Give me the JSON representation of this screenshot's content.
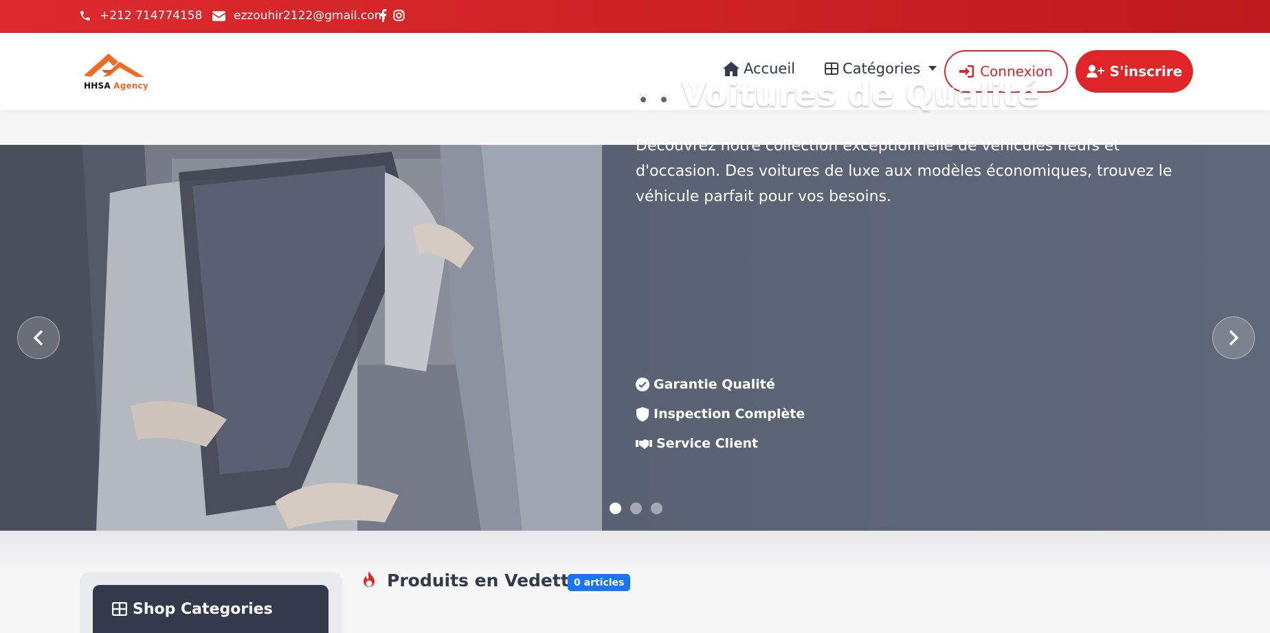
{
  "topbar": {
    "phone": "+212 714774158",
    "email": "ezzouhir2122@gmail.com",
    "icons": [
      "phone-icon",
      "envelope-icon",
      "facebook-icon",
      "instagram-icon"
    ],
    "background": "#d92327"
  },
  "logo": {
    "brand": "HHSA",
    "suffix": "Agency",
    "accent": "#f26a23"
  },
  "nav": {
    "home": "Accueil",
    "categories": "Catégories",
    "login": "Connexion",
    "signup": "S'inscrire"
  },
  "hero": {
    "title": "Voitures de Qualité",
    "description": "Découvrez notre collection exceptionnelle de véhicules neufs et d'occasion. Des voitures de luxe aux modèles économiques, trouvez le véhicule parfait pour vos besoins.",
    "features": [
      {
        "label": "Garantie Qualité",
        "icon": "check-circle-icon"
      },
      {
        "label": "Inspection Complète",
        "icon": "shield-icon"
      },
      {
        "label": "Service Client",
        "icon": "handshake-icon"
      }
    ],
    "slide_count": 3,
    "active_slide": 1,
    "panel_color": "#5d6677"
  },
  "shop": {
    "categories_title": "Shop Categories",
    "featured_title": "Produits en Vedette",
    "featured_count": "0 articles",
    "badge_color": "#1976f2",
    "accent": "#df2528"
  }
}
